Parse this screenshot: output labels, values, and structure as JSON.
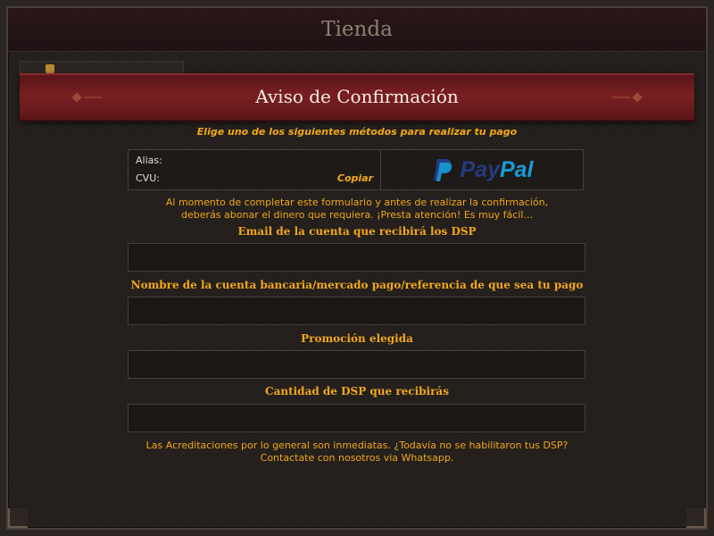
{
  "window": {
    "title": "Tienda"
  },
  "dialog": {
    "title": "Aviso de Confirmación"
  },
  "payment": {
    "instruction": "Elige uno de los siguientes métodos para realizar tu pago",
    "alias_label": "Alias:",
    "cvu_label": "CVU:",
    "copy_label": "Copiar",
    "paypal_pay": "Pay",
    "paypal_pal": "Pal",
    "paypal_icon": "paypal-logo-icon"
  },
  "info": {
    "line1": "Al momento de completar este formulario y antes de realizar la confirmación,",
    "line2": "deberás abonar el dinero que requiera. ¡Presta atención! Es muy fácil..."
  },
  "form": {
    "email_label": "Email de la cuenta que recibirá los DSP",
    "email_value": "",
    "account_label": "Nombre de la cuenta bancaria/mercado pago/referencia de que sea tu pago",
    "account_value": "",
    "promo_label": "Promoción elegida",
    "promo_value": "",
    "amount_label": "Cantidad de DSP que recibirás",
    "amount_value": ""
  },
  "footer": {
    "line1": "Las Acreditaciones por lo general son inmediatas. ¿Todavía no se habilitaron tus DSP?",
    "line2": "Contactate con nosotros via Whatsapp."
  },
  "colors": {
    "accent": "#f0a81a",
    "banner": "#7a1f22",
    "background": "#241f1c",
    "paypal_dark": "#253b80",
    "paypal_light": "#179bd7"
  }
}
